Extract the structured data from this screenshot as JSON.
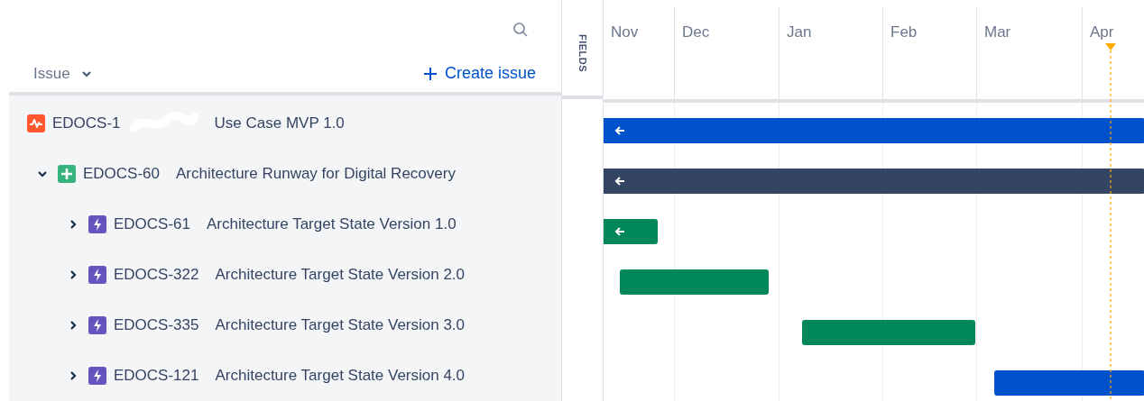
{
  "header": {
    "column_label": "Issue",
    "create_link": "Create issue",
    "fields_tab": "FIELDS"
  },
  "months": [
    "Nov",
    "Dec",
    "Jan",
    "Feb",
    "Mar",
    "Apr"
  ],
  "issues": [
    {
      "kind": "initiative",
      "key": "EDOCS-1",
      "title": "Use Case MVP 1.0",
      "redacted": true,
      "bar": {
        "color": "#0052cc",
        "arrow": true
      },
      "children": [
        {
          "kind": "feature",
          "key": "EDOCS-60",
          "title": "Architecture Runway for Digital Recovery",
          "expanded": true,
          "bar": {
            "color": "#344563",
            "arrow": true
          },
          "children": [
            {
              "kind": "epic",
              "key": "EDOCS-61",
              "title": "Architecture Target State Version 1.0",
              "expanded": false,
              "bar": {
                "color": "#00875a",
                "arrow": true
              }
            },
            {
              "kind": "epic",
              "key": "EDOCS-322",
              "title": "Architecture Target State Version 2.0",
              "expanded": false,
              "bar": {
                "color": "#00875a",
                "arrow": false
              }
            },
            {
              "kind": "epic",
              "key": "EDOCS-335",
              "title": "Architecture Target State Version 3.0",
              "expanded": false,
              "bar": {
                "color": "#00875a",
                "arrow": false
              }
            },
            {
              "kind": "epic",
              "key": "EDOCS-121",
              "title": "Architecture Target State Version 4.0",
              "expanded": false,
              "bar": {
                "color": "#0052cc",
                "arrow": false
              }
            }
          ]
        }
      ]
    }
  ]
}
